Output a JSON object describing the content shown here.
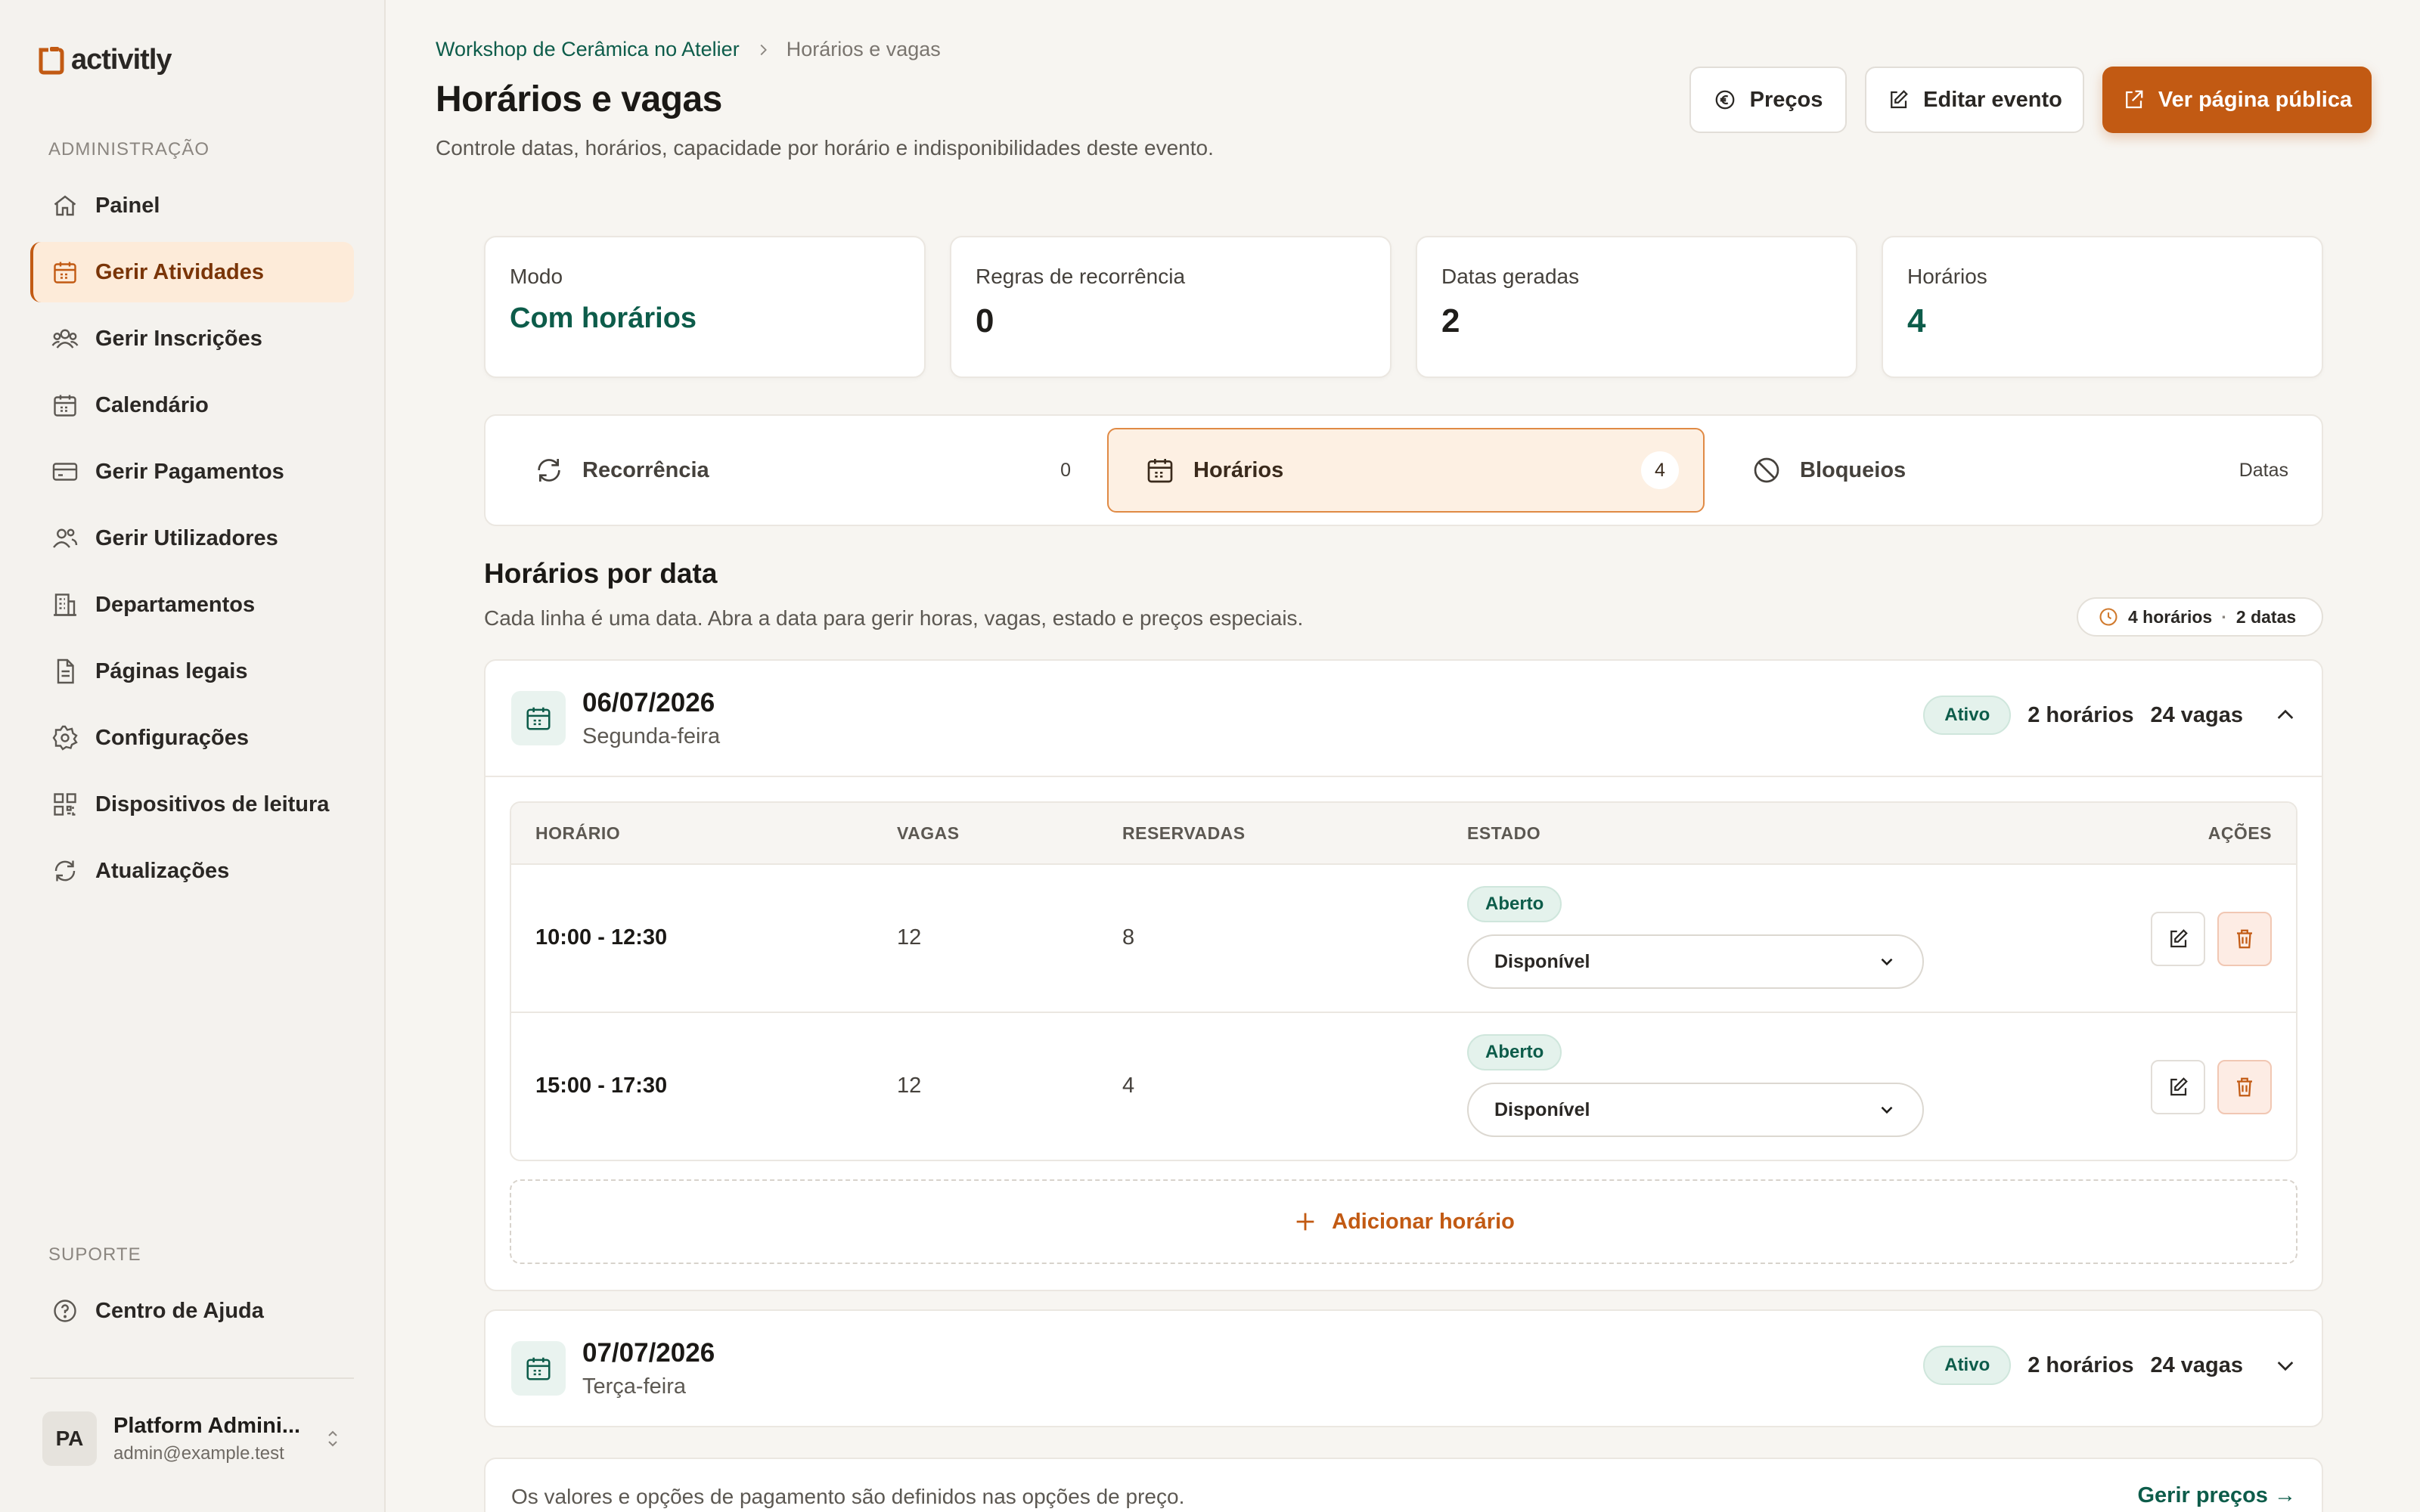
{
  "app": {
    "name": "activitly"
  },
  "sidebar": {
    "admin_label": "ADMINISTRAÇÃO",
    "items": [
      {
        "label": "Painel",
        "icon": "home-icon"
      },
      {
        "label": "Gerir Atividades",
        "icon": "calendar-icon",
        "active": true
      },
      {
        "label": "Gerir Inscrições",
        "icon": "users-icon"
      },
      {
        "label": "Calendário",
        "icon": "calendar-icon"
      },
      {
        "label": "Gerir Pagamentos",
        "icon": "credit-card-icon"
      },
      {
        "label": "Gerir Utilizadores",
        "icon": "users-icon"
      },
      {
        "label": "Departamentos",
        "icon": "building-icon"
      },
      {
        "label": "Páginas legais",
        "icon": "document-icon"
      },
      {
        "label": "Configurações",
        "icon": "gear-icon"
      },
      {
        "label": "Dispositivos de leitura",
        "icon": "qr-code-icon"
      },
      {
        "label": "Atualizações",
        "icon": "refresh-icon"
      }
    ],
    "support_label": "SUPORTE",
    "support_items": [
      {
        "label": "Centro de Ajuda",
        "icon": "help-circle-icon"
      }
    ],
    "user": {
      "initials": "PA",
      "name": "Platform Admini...",
      "email": "admin@example.test"
    }
  },
  "header": {
    "breadcrumb": {
      "parent": "Workshop de Cerâmica no Atelier",
      "current": "Horários e vagas"
    },
    "title": "Horários e vagas",
    "subtitle": "Controle datas, horários, capacidade por horário e indisponibilidades deste evento.",
    "buttons": {
      "prices": "Preços",
      "edit": "Editar evento",
      "public": "Ver página pública"
    }
  },
  "stats": [
    {
      "label": "Modo",
      "value": "Com horários"
    },
    {
      "label": "Regras de recorrência",
      "value": "0"
    },
    {
      "label": "Datas geradas",
      "value": "2"
    },
    {
      "label": "Horários",
      "value": "4"
    }
  ],
  "tabs": [
    {
      "label": "Recorrência",
      "count": "0",
      "icon": "refresh-icon"
    },
    {
      "label": "Horários",
      "count": "4",
      "icon": "calendar-icon",
      "active": true
    },
    {
      "label": "Bloqueios",
      "count": "Datas",
      "icon": "ban-icon"
    }
  ],
  "section": {
    "title": "Horários por data",
    "subtitle": "Cada linha é uma data. Abra a data para gerir horas, vagas, estado e preços especiais.",
    "summary_slots": "4 horários",
    "summary_dates": "2 datas"
  },
  "table_headers": {
    "time": "HORÁRIO",
    "slots": "VAGAS",
    "booked": "RESERVADAS",
    "state": "ESTADO",
    "actions": "AÇÕES"
  },
  "dates": [
    {
      "date": "06/07/2026",
      "weekday": "Segunda-feira",
      "status": "Ativo",
      "slots_count": "2 horários",
      "capacity": "24 vagas",
      "expanded": true,
      "rows": [
        {
          "time": "10:00 - 12:30",
          "slots": "12",
          "booked": "8",
          "badge": "Aberto",
          "select": "Disponível"
        },
        {
          "time": "15:00 - 17:30",
          "slots": "12",
          "booked": "4",
          "badge": "Aberto",
          "select": "Disponível"
        }
      ],
      "add_label": "Adicionar horário"
    },
    {
      "date": "07/07/2026",
      "weekday": "Terça-feira",
      "status": "Ativo",
      "slots_count": "2 horários",
      "capacity": "24 vagas",
      "expanded": false
    }
  ],
  "footer": {
    "text": "Os valores e opções de pagamento são definidos nas opções de preço.",
    "link": "Gerir preços →"
  },
  "colors": {
    "accent": "#c25a13",
    "brand_green": "#0d5c4a",
    "background": "#f7f5f1"
  }
}
